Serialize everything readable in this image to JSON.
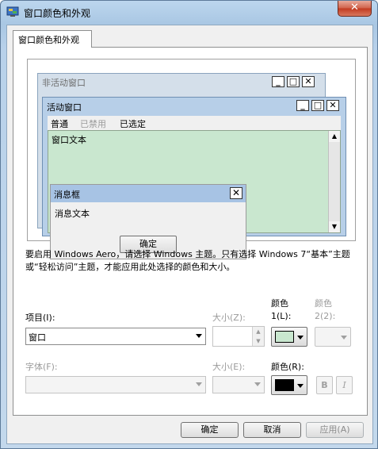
{
  "window": {
    "title": "窗口颜色和外观",
    "close_glyph": "✕"
  },
  "tab": {
    "label": "窗口颜色和外观"
  },
  "preview": {
    "inactive_title": "非活动窗口",
    "active_title": "活动窗口",
    "menu": [
      "普通",
      "已禁用",
      "已选定"
    ],
    "window_text": "窗口文本",
    "msgbox_title": "消息框",
    "msgbox_text": "消息文本",
    "msgbox_ok": "确定",
    "caption_min": "_",
    "caption_max": "□",
    "caption_close": "✕"
  },
  "info_text": "要启用 Windows Aero，请选择 Windows 主题。只有选择 Windows 7“基本”主题或“轻松访问”主题，才能应用此处选择的颜色和大小。",
  "item": {
    "label": "项目(I):",
    "value": "窗口"
  },
  "size1": {
    "label": "大小(Z):"
  },
  "color1": {
    "label_line1": "颜色",
    "label_line2": "1(L):",
    "swatch": "#c9e7cf"
  },
  "color2": {
    "label_line1": "颜色",
    "label_line2": "2(2):"
  },
  "font": {
    "label": "字体(F):"
  },
  "size2": {
    "label": "大小(E):"
  },
  "fontcolor": {
    "label": "颜色(R):",
    "swatch": "#000000"
  },
  "bold_label": "B",
  "italic_label": "I",
  "footer": {
    "ok": "确定",
    "cancel": "取消",
    "apply": "应用(A)"
  }
}
